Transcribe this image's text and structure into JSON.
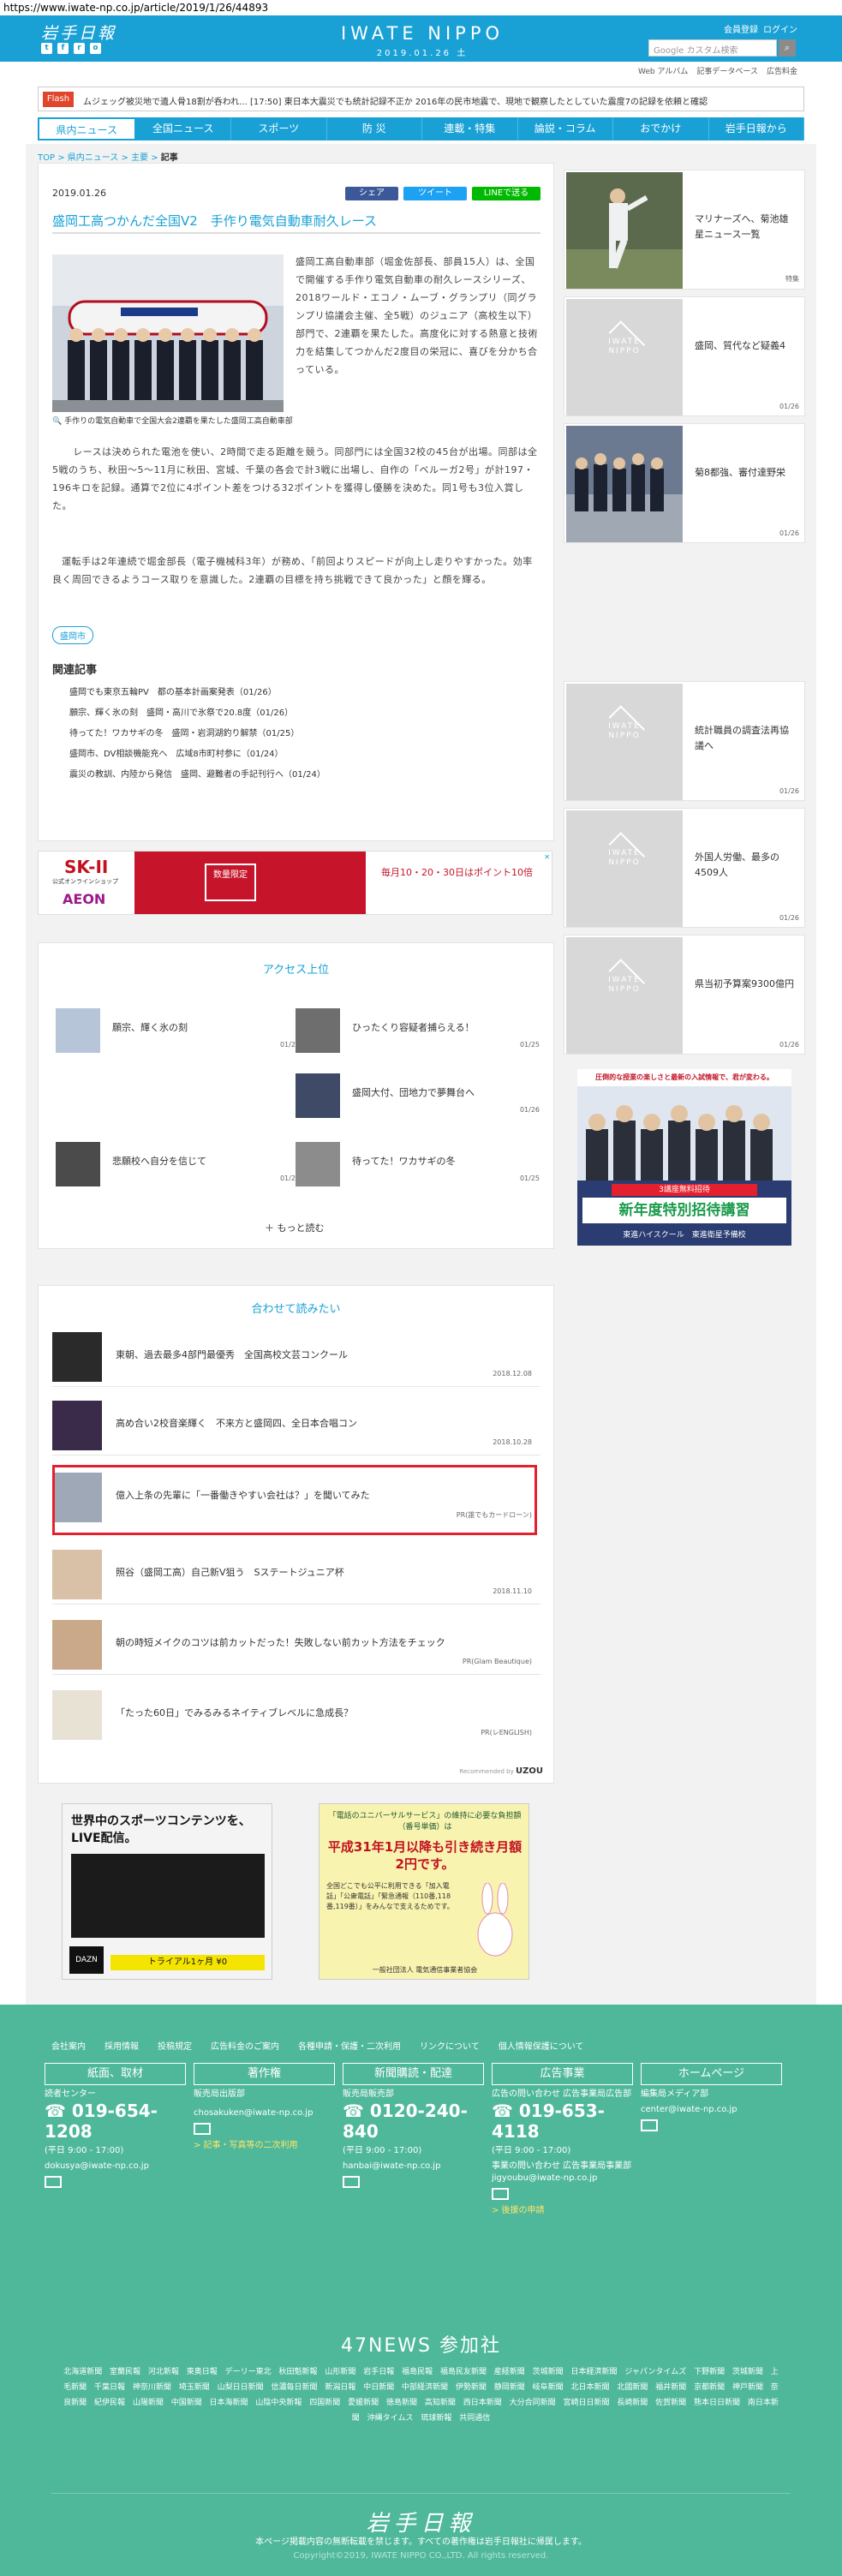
{
  "browser": {
    "url": "https://www.iwate-np.co.jp/article/2019/1/26/44893"
  },
  "header": {
    "logo_ja": "岩手日報",
    "logo_en": "IWATE NIPPO",
    "date": "2019.01.26 土",
    "links": [
      "会員登録",
      "ログイン"
    ],
    "search_placeholder": "Google カスタム検索",
    "subnav": [
      "Web アルバム",
      "記事データベース",
      "広告料金"
    ]
  },
  "flash": {
    "label": "Flash",
    "text": "ムジェッグ被災地で遺人骨18割が呑われ...   [17:50] 東日本大震災でも統計記録不正か   2016年の民市地震で、現地で観察したとしていた震度7の記録を依頼と確認"
  },
  "nav": [
    "県内ニュース",
    "全国ニュース",
    "スポーツ",
    "防 災",
    "連載・特集",
    "論説・コラム",
    "おでかけ",
    "岩手日報から"
  ],
  "breadcrumb": [
    "TOP",
    "県内ニュース",
    "主要",
    "記事"
  ],
  "article": {
    "date": "2019.01.26",
    "share_labels": [
      "シェア",
      "ツイート",
      "LINEで送る"
    ],
    "title": "盛岡工高つかんだ全国V2　手作り電気自動車耐久レース",
    "caption": "手作りの電気自動車で全国大会2連覇を果たした盛岡工高自動車部",
    "paragraph1": "盛岡工高自動車部（堀金佐部長、部員15人）は、全国で開催する手作り電気自動車の耐久レースシリーズ、2018ワールド・エコノ・ムーブ・グランプリ（同グランプリ協議会主催、全5戦）のジュニア（高校生以下）部門で、2連覇を果たした。高度化に対する熱意と技術力を結集してつかんだ2度目の栄冠に、喜びを分かち合っている。",
    "paragraph2": "レースは決められた電池を使い、2時間で走る距離を競う。同部門には全国32校の45台が出場。同部は全5戦のうち、秋田～5～11月に秋田、宮城、千葉の各会で計3戦に出場し、自作の「ベルーガ2号」が計197・196キロを記録。通算で2位に4ポイント差をつける32ポイントを獲得し優勝を決めた。同1号も3位入賞した。",
    "paragraph3": "運転手は2年連続で堀金部長（電子機械科3年）が務め、「前回よりスピードが向上し走りやすかった。効率良く周回できるようコース取りを意識した。2連覇の目標を持ち挑戦できて良かった」と顔を輝る。",
    "tag": "盛岡市",
    "related_heading": "関連記事",
    "related": [
      "盛岡でも東京五輪PV　都の基本計画案発表（01/26）",
      "願宗、輝く氷の刻　盛岡・高川で氷祭で20.8度（01/26）",
      "待ってた！ワカサギの冬　盛岡・岩洞湖釣り解禁（01/25）",
      "盛岡市、DV相談機能充へ　広域8市町村参に（01/24）",
      "震災の教訓、内陸から発信　盛岡、避難者の手記刊行へ（01/24）"
    ]
  },
  "sidebar": [
    {
      "title": "マリナーズへ、菊池雄星ニュース一覧",
      "date": "特集"
    },
    {
      "title": "盛岡、質代など疑義4",
      "date": "01/26"
    },
    {
      "title": "菊8都強、審付達野栄",
      "date": "01/26"
    },
    {
      "title": "統計職員の調査法再協議へ",
      "date": "01/26"
    },
    {
      "title": "外国人労働、最多の4509人",
      "date": "01/26"
    },
    {
      "title": "県当初予算案9300億円",
      "date": "01/26"
    }
  ],
  "ads": {
    "wide_brand": "SK-II",
    "wide_sub": "公式オンラインショップ",
    "wide_store": "AEON",
    "wide_mid": "数量限定",
    "wide_right": "毎月10・20・30日はポイント10倍",
    "side_top": "圧倒的な授業の楽しさと最新の入試情報で、君が変わる。",
    "side_banner": "新年度特別招待講習",
    "side_sub": "3講座無料招待",
    "side_school": "東進ハイスクール　東進衛星予備校",
    "bottom_left_title": "世界中のスポーツコンテンツを、LIVE配信。",
    "bottom_left_cta": "トライアル1ヶ月 ¥0",
    "bottom_left_brand": "DAZN",
    "bottom_right_top": "「電話のユニバーサルサービス」の維持に必要な負担額（番号単価）は",
    "bottom_right_main": "平成31年1月以降も引き続き月額2円です。",
    "bottom_right_sub": "全国どこでも公平に利用できる「加入電話」「公衆電話」「緊急通報（110番,118番,119番）」をみんなで支えるためです。",
    "bottom_right_org": "一般社団法人 電気通信事業者協会"
  },
  "access": {
    "heading": "アクセス上位",
    "items": [
      {
        "title": "願宗、輝く氷の刻",
        "date": "01/26"
      },
      {
        "title": "ひったくり容疑者捕らえる！",
        "date": "01/25"
      },
      {
        "title": "盛岡大付、団地力で夢舞台へ",
        "date": "01/26"
      },
      {
        "title": "悲願校へ自分を信じて",
        "date": "01/26"
      },
      {
        "title": "待ってた！ワカサギの冬",
        "date": "01/25"
      }
    ],
    "more": "もっと読む"
  },
  "together": {
    "heading": "合わせて読みたい",
    "items": [
      {
        "title": "東朝、過去最多4部門最優秀　全国高校文芸コンクール",
        "meta": "2018.12.08"
      },
      {
        "title": "高め合い2校音楽輝く　不来方と盛岡四、全日本合唱コン",
        "meta": "2018.10.28"
      },
      {
        "title": "億入上条の先輩に「一番働きやすい会社は？」を聞いてみた",
        "meta": "PR(誰でもカードローン)"
      },
      {
        "title": "照谷（盛岡工高）自己新V狙う　Sステートジュニア杯",
        "meta": "2018.11.10"
      },
      {
        "title": "朝の時短メイクのコツは前カットだった！失敗しない前カット方法をチェック",
        "meta": "PR(Glam Beautique)"
      },
      {
        "title": "「たった60日」でみるみるネイティブレベルに急成長？",
        "meta": "PR(レENGLISH)"
      }
    ],
    "recommended_by": "Recommended by",
    "recommend_brand": "UZOU"
  },
  "footer": {
    "links": [
      "会社案内",
      "採用情報",
      "投稿規定",
      "広告料金のご案内",
      "各種申請・保護・二次利用",
      "リンクについて",
      "個人情報保護について"
    ],
    "cols": [
      {
        "box": "紙面、取材",
        "l1": "読者センター",
        "phone": "019-654-1208",
        "hours": "(平日 9:00 - 17:00)",
        "mail": "dokusya@iwate-np.co.jp",
        "extra": ""
      },
      {
        "box": "著作権",
        "l1": "販売局出版部",
        "phone": "",
        "hours": "",
        "mail": "chosakuken@iwate-np.co.jp",
        "extra": "> 記事・写真等の二次利用"
      },
      {
        "box": "新聞購読・配達",
        "l1": "販売局販売部",
        "phone": "0120-240-840",
        "hours": "(平日 9:00 - 17:00)",
        "mail": "hanbai@iwate-np.co.jp",
        "extra": ""
      },
      {
        "box": "広告事業",
        "l1": "広告の問い合わせ 広告事業局広告部",
        "phone": "019-653-4118",
        "hours": "(平日 9:00 - 17:00)",
        "mail": "事業の問い合わせ 広告事業局事業部 jigyoubu@iwate-np.co.jp",
        "extra": "> 後援の申請"
      },
      {
        "box": "ホームページ",
        "l1": "編集局メディア部",
        "phone": "",
        "hours": "",
        "mail": "center@iwate-np.co.jp",
        "extra": ""
      }
    ],
    "news47": "47NEWS 参加社",
    "papers": "北海道新聞 室蘭民報 河北新報 東奥日報 デーリー東北 秋田魁新報 山形新聞 岩手日報 福島民報 福島民友新聞 産経新聞 茨城新聞 日本経済新聞 ジャパンタイムズ 下野新聞 茨城新聞 上毛新聞 千葉日報 神奈川新聞 埼玉新聞 山梨日日新聞 信濃毎日新聞 新潟日報 中日新聞 中部経済新聞 伊勢新聞 静岡新聞 岐阜新聞 北日本新聞 北國新聞 福井新聞 京都新聞 神戸新聞 奈良新聞 紀伊民報 山陽新聞 中国新聞 日本海新聞 山陰中央新報 四国新聞 愛媛新聞 徳島新聞 高知新聞 西日本新聞 大分合同新聞 宮崎日日新聞 長崎新聞 佐賀新聞 熊本日日新聞 南日本新聞 沖縄タイムス 琉球新報 共同通信",
    "logo": "岩手日報",
    "notice": "本ページ掲載内容の無断転載を禁じます。すべての著作権は岩手日報社に帰属します。",
    "copyright": "Copyright©2019, IWATE NIPPO CO.,LTD. All rights reserved."
  },
  "colors": {
    "brand_blue": "#19a1d6",
    "footer_green": "#4fb89a",
    "flash_red": "#e0462b",
    "highlight_red": "#e5202e"
  }
}
